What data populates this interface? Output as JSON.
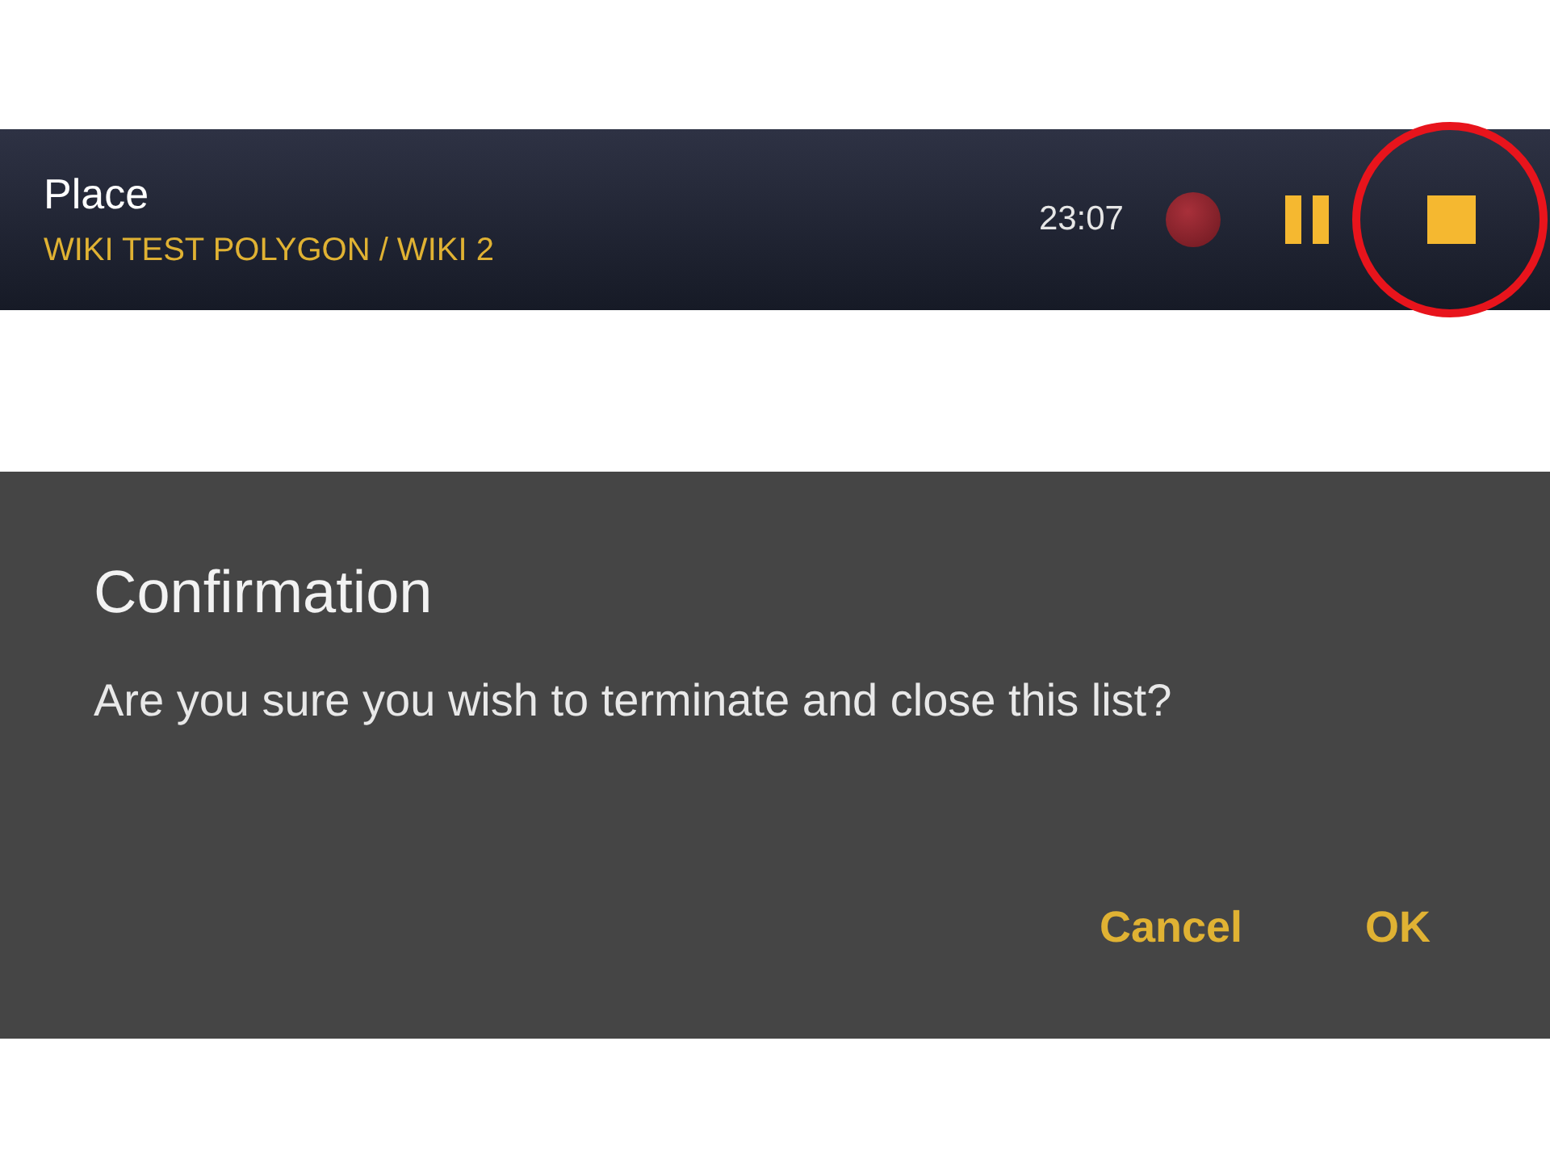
{
  "toolbar": {
    "title": "Place",
    "subtitle": "WIKI TEST POLYGON / WIKI 2",
    "timer": "23:07",
    "stop_highlighted": true
  },
  "dialog": {
    "title": "Confirmation",
    "message": "Are you sure you wish to terminate and close this list?",
    "buttons": [
      "Cancel",
      "OK"
    ]
  }
}
